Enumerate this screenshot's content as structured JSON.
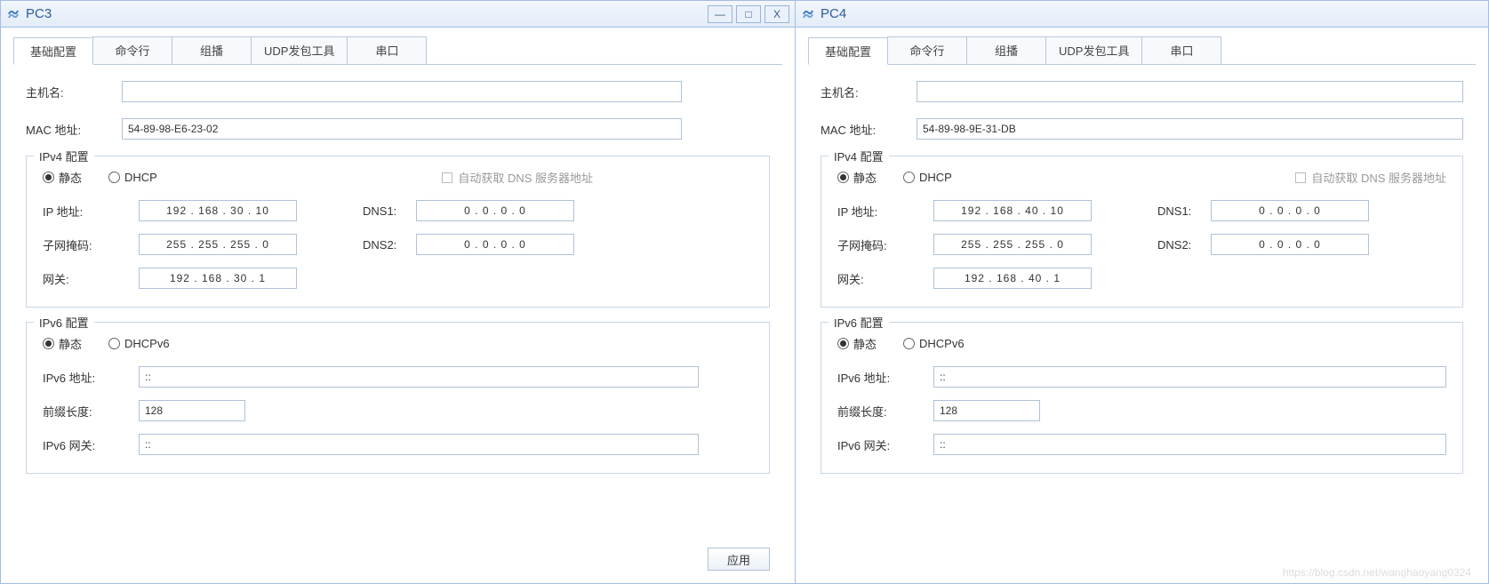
{
  "watermark": "https://blog.csdn.net/wanghaoyang0324",
  "tabs": [
    "基础配置",
    "命令行",
    "组播",
    "UDP发包工具",
    "串口"
  ],
  "labels": {
    "hostname": "主机名:",
    "mac": "MAC 地址:",
    "ipv4_legend": "IPv4 配置",
    "static": "静态",
    "dhcp": "DHCP",
    "auto_dns": "自动获取 DNS 服务器地址",
    "ip": "IP 地址:",
    "mask": "子网掩码:",
    "gw": "网关:",
    "dns1": "DNS1:",
    "dns2": "DNS2:",
    "ipv6_legend": "IPv6 配置",
    "dhcpv6": "DHCPv6",
    "ipv6_addr": "IPv6 地址:",
    "prefix": "前缀长度:",
    "ipv6_gw": "IPv6 网关:",
    "apply": "应用"
  },
  "pc3": {
    "title": "PC3",
    "hostname": "",
    "mac": "54-89-98-E6-23-02",
    "ipv4": {
      "ip": "192  .  168  .  30  .  10",
      "mask": "255  .  255  .  255  .  0",
      "gw": "192  .  168  .  30  .  1",
      "dns1": "0  .  0  .  0  .  0",
      "dns2": "0  .  0  .  0  .  0"
    },
    "ipv6": {
      "addr": "::",
      "prefix": "128",
      "gw": "::"
    }
  },
  "pc4": {
    "title": "PC4",
    "hostname": "",
    "mac": "54-89-98-9E-31-DB",
    "ipv4": {
      "ip": "192  .  168  .  40  .  10",
      "mask": "255  .  255  .  255  .  0",
      "gw": "192  .  168  .  40  .  1",
      "dns1": "0  .  0  .  0  .  0",
      "dns2": "0  .  0  .  0  .  0"
    },
    "ipv6": {
      "addr": "::",
      "prefix": "128",
      "gw": "::"
    }
  }
}
